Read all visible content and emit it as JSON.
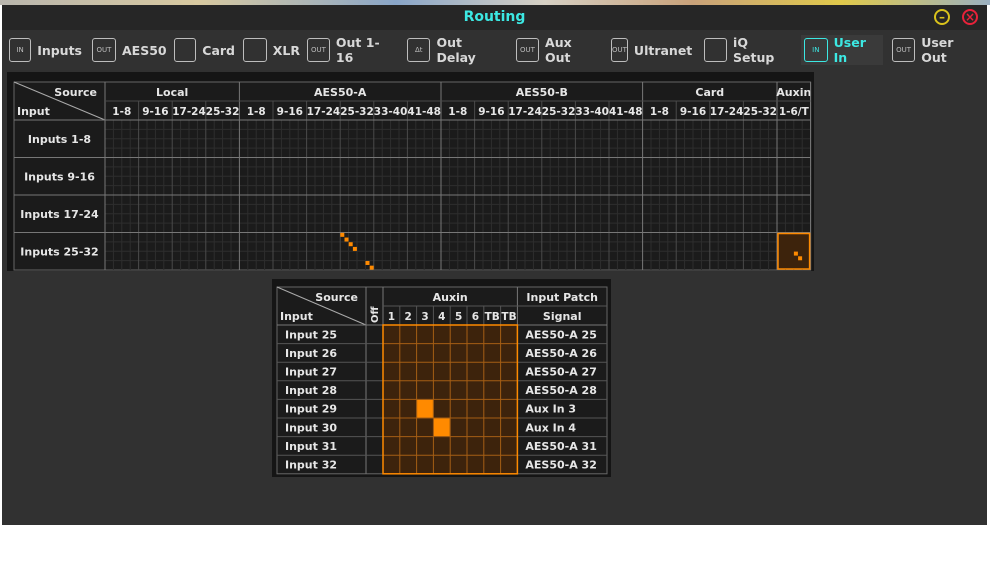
{
  "window": {
    "title": "Routing"
  },
  "tabs": [
    {
      "label": "Inputs",
      "icon": "in-icon",
      "badge": "IN"
    },
    {
      "label": "AES50",
      "icon": "out-icon",
      "badge": "OUT"
    },
    {
      "label": "Card",
      "icon": "card-icon",
      "badge": ""
    },
    {
      "label": "XLR",
      "icon": "xlr-icon",
      "badge": ""
    },
    {
      "label": "Out 1-16",
      "icon": "out-icon",
      "badge": "OUT"
    },
    {
      "label": "Out Delay",
      "icon": "delay-icon",
      "badge": "Δt"
    },
    {
      "label": "Aux Out",
      "icon": "out-icon",
      "badge": "OUT"
    },
    {
      "label": "Ultranet",
      "icon": "out-icon",
      "badge": "OUT"
    },
    {
      "label": "iQ Setup",
      "icon": "speaker-icon",
      "badge": ""
    },
    {
      "label": "User In",
      "icon": "in-icon",
      "badge": "IN",
      "active": true
    },
    {
      "label": "User Out",
      "icon": "out-icon",
      "badge": "OUT"
    }
  ],
  "top_matrix": {
    "corner_source": "Source",
    "corner_input": "Input",
    "groups": [
      {
        "name": "Local",
        "cols": [
          "1-8",
          "9-16",
          "17-24",
          "25-32"
        ]
      },
      {
        "name": "AES50-A",
        "cols": [
          "1-8",
          "9-16",
          "17-24",
          "25-32",
          "33-40",
          "41-48"
        ]
      },
      {
        "name": "AES50-B",
        "cols": [
          "1-8",
          "9-16",
          "17-24",
          "25-32",
          "33-40",
          "41-48"
        ]
      },
      {
        "name": "Card",
        "cols": [
          "1-8",
          "9-16",
          "17-24",
          "25-32"
        ]
      },
      {
        "name": "Auxin",
        "cols": [
          "1-6/T"
        ]
      }
    ],
    "rows": [
      "Inputs 1-8",
      "Inputs 9-16",
      "Inputs 17-24",
      "Inputs 25-32"
    ],
    "patched": [
      {
        "row": "Inputs 25-32",
        "col": "AES50-A 25-32",
        "channels": [
          1,
          2,
          3,
          4,
          7,
          8
        ]
      },
      {
        "row": "Inputs 25-32",
        "col": "Auxin 1-6/T",
        "channels": [
          5,
          6
        ]
      }
    ]
  },
  "detail_matrix": {
    "corner_source": "Source",
    "corner_input": "Input",
    "off_label": "Off",
    "group": "Auxin",
    "cols": [
      "1",
      "2",
      "3",
      "4",
      "5",
      "6",
      "TB",
      "TB"
    ],
    "patch_header": "Input Patch",
    "signal_header": "Signal",
    "rows": [
      {
        "input": "Input 25",
        "signal": "AES50-A 25",
        "on": null
      },
      {
        "input": "Input 26",
        "signal": "AES50-A 26",
        "on": null
      },
      {
        "input": "Input 27",
        "signal": "AES50-A 27",
        "on": null
      },
      {
        "input": "Input 28",
        "signal": "AES50-A 28",
        "on": null
      },
      {
        "input": "Input 29",
        "signal": "Aux In 3",
        "on": 2
      },
      {
        "input": "Input 30",
        "signal": "Aux In 4",
        "on": 3
      },
      {
        "input": "Input 31",
        "signal": "AES50-A 31",
        "on": null
      },
      {
        "input": "Input 32",
        "signal": "AES50-A 32",
        "on": null
      }
    ]
  },
  "colors": {
    "accent": "#3ce8e3",
    "patch": "#ff8a00",
    "patch_bg": "#3d230c",
    "grid": "#4a4a4a"
  }
}
